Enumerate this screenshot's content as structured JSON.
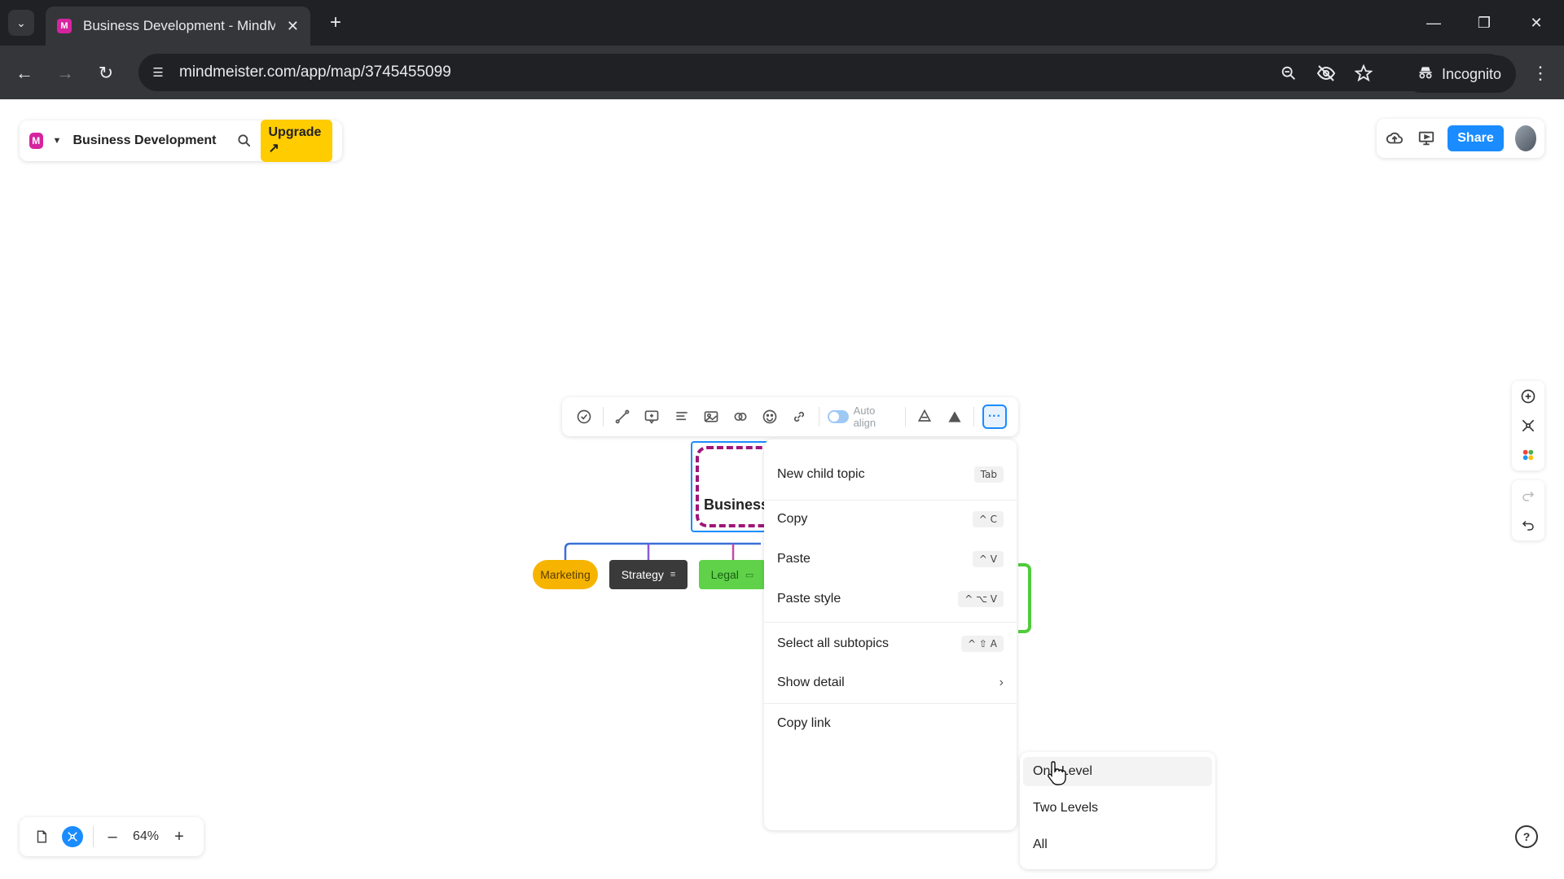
{
  "browser": {
    "tab_title": "Business Development - MindMeister",
    "url": "mindmeister.com/app/map/3745455099",
    "incognito_label": "Incognito"
  },
  "app": {
    "logo_letter": "M",
    "map_name": "Business Development",
    "upgrade_label": "Upgrade ↗",
    "share_label": "Share",
    "zoom_level": "64%"
  },
  "mindmap": {
    "root_label": "Business",
    "auto_align_label": "Auto align",
    "more_label": "···",
    "children": [
      {
        "label": "Marketing"
      },
      {
        "label": "Strategy"
      },
      {
        "label": "Legal"
      }
    ]
  },
  "context_menu": {
    "items": [
      {
        "label": "New child topic",
        "shortcut": "Tab"
      },
      {
        "label": "Copy",
        "shortcut": "^ C"
      },
      {
        "label": "Paste",
        "shortcut": "^ V"
      },
      {
        "label": "Paste style",
        "shortcut": "^ ⌥ V"
      },
      {
        "label": "Select all subtopics",
        "shortcut": "^ ⇧ A"
      },
      {
        "label": "Show detail",
        "shortcut": "›"
      },
      {
        "label": "Copy link",
        "shortcut": ""
      }
    ]
  },
  "submenu": {
    "items": [
      {
        "label": "One Level"
      },
      {
        "label": "Two Levels"
      },
      {
        "label": "All"
      }
    ]
  },
  "colors": {
    "brand": "#d6249f",
    "upgrade": "#ffcc00",
    "share": "#1a8cff",
    "marketing": "#f6b400",
    "strategy": "#3a3a3a",
    "legal": "#5fd24a"
  }
}
